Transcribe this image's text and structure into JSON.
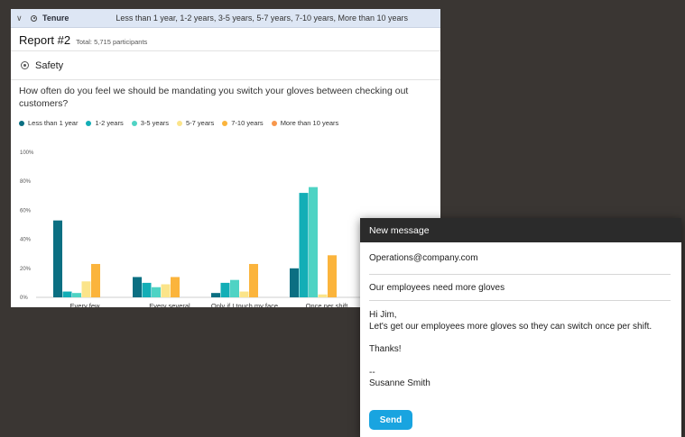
{
  "filter": {
    "name": "Tenure",
    "values": "Less than 1 year, 1-2 years, 3-5 years, 5-7 years, 7-10 years, More than 10 years"
  },
  "report": {
    "title": "Report #2",
    "total": "Total: 5,715 participants",
    "category": "Safety",
    "question": "How often do you feel we should be mandating you switch your gloves between checking out customers?"
  },
  "chart_data": {
    "type": "bar",
    "categories": [
      "Every few",
      "Every several",
      "Only if I touch my face",
      "Once per shift"
    ],
    "series": [
      {
        "name": "Less than 1 year",
        "color": "#0b6f82",
        "values": [
          53,
          14,
          3,
          20
        ]
      },
      {
        "name": "1-2 years",
        "color": "#13aeb6",
        "values": [
          4,
          10,
          10,
          72
        ]
      },
      {
        "name": "3-5 years",
        "color": "#4fd3c4",
        "values": [
          3,
          7,
          12,
          76
        ]
      },
      {
        "name": "5-7 years",
        "color": "#fbe48a",
        "values": [
          11,
          9,
          4,
          2
        ]
      },
      {
        "name": "7-10 years",
        "color": "#fbb43c",
        "values": [
          23,
          14,
          23,
          29
        ]
      }
    ],
    "yticks": [
      "100%",
      "80%",
      "60%",
      "40%",
      "20%",
      "0%"
    ],
    "ylim": [
      0,
      100
    ]
  },
  "legend": [
    {
      "label": "Less than 1 year",
      "color": "#0b6f82"
    },
    {
      "label": "1-2 years",
      "color": "#13aeb6"
    },
    {
      "label": "3-5 years",
      "color": "#4fd3c4"
    },
    {
      "label": "5-7 years",
      "color": "#fbe48a"
    },
    {
      "label": "7-10 years",
      "color": "#fbb43c"
    },
    {
      "label": "More than 10 years",
      "color": "#f7974c"
    }
  ],
  "compose": {
    "header": "New message",
    "to": "Operations@company.com",
    "subject": "Our employees need more gloves",
    "body": {
      "greeting": "Hi Jim,",
      "line1": "Let's get our employees more gloves so they can switch once per shift.",
      "thanks": "Thanks!",
      "dash": "--",
      "signature": "Susanne Smith"
    },
    "send_label": "Send"
  }
}
